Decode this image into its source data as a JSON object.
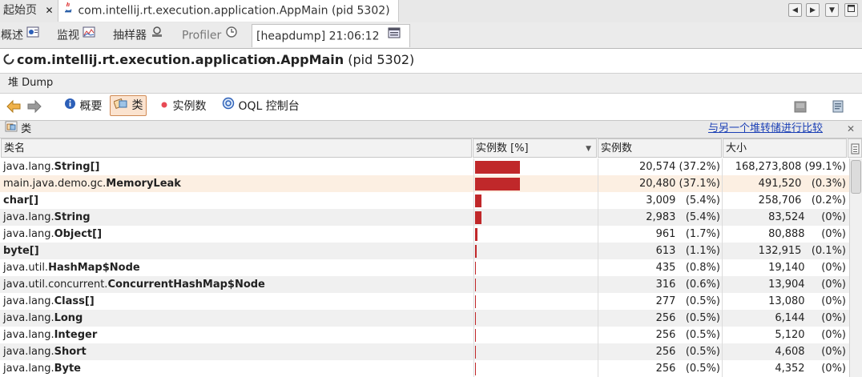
{
  "doc_tabs": [
    {
      "label": "起始页"
    },
    {
      "label": "com.intellij.rt.execution.application.AppMain (pid 5302)"
    }
  ],
  "sub_tabs": [
    {
      "label": "概述"
    },
    {
      "label": "监视"
    },
    {
      "label": "抽样器"
    },
    {
      "label": "Profiler"
    },
    {
      "label": "[heapdump] 21:06:12"
    }
  ],
  "title": {
    "app": "com.intellij.rt.execution.application.AppMain",
    "pid": "(pid 5302)"
  },
  "heap_dump_label": "堆 Dump",
  "toolbar": {
    "summary": "概要",
    "classes": "类",
    "instances": "实例数",
    "oql": "OQL 控制台"
  },
  "classes_panel": {
    "title": "类",
    "compare_link": "与另一个堆转储进行比较"
  },
  "columns": {
    "name": "类名",
    "instances_pct": "实例数 [%]",
    "instances": "实例数",
    "size": "大小"
  },
  "rows": [
    {
      "pkg": "java.lang.",
      "cls": "String[]",
      "pct": 37.2,
      "inst": "20,574 (37.2%)",
      "size": "168,273,808 (99.1%)"
    },
    {
      "pkg": "main.java.demo.gc.",
      "cls": "MemoryLeak",
      "pct": 37.1,
      "inst": "20,480 (37.1%)",
      "size": "491,520   (0.3%)"
    },
    {
      "pkg": "",
      "cls": "char[]",
      "pct": 5.4,
      "inst": "3,009   (5.4%)",
      "size": "258,706   (0.2%)"
    },
    {
      "pkg": "java.lang.",
      "cls": "String",
      "pct": 5.4,
      "inst": "2,983   (5.4%)",
      "size": "83,524     (0%)"
    },
    {
      "pkg": "java.lang.",
      "cls": "Object[]",
      "pct": 1.7,
      "inst": "961   (1.7%)",
      "size": "80,888     (0%)"
    },
    {
      "pkg": "",
      "cls": "byte[]",
      "pct": 1.1,
      "inst": "613   (1.1%)",
      "size": "132,915   (0.1%)"
    },
    {
      "pkg": "java.util.",
      "cls": "HashMap$Node",
      "pct": 0.8,
      "inst": "435   (0.8%)",
      "size": "19,140     (0%)"
    },
    {
      "pkg": "java.util.concurrent.",
      "cls": "ConcurrentHashMap$Node",
      "pct": 0.6,
      "inst": "316   (0.6%)",
      "size": "13,904     (0%)"
    },
    {
      "pkg": "java.lang.",
      "cls": "Class[]",
      "pct": 0.5,
      "inst": "277   (0.5%)",
      "size": "13,080     (0%)"
    },
    {
      "pkg": "java.lang.",
      "cls": "Long",
      "pct": 0.5,
      "inst": "256   (0.5%)",
      "size": "6,144     (0%)"
    },
    {
      "pkg": "java.lang.",
      "cls": "Integer",
      "pct": 0.5,
      "inst": "256   (0.5%)",
      "size": "5,120     (0%)"
    },
    {
      "pkg": "java.lang.",
      "cls": "Short",
      "pct": 0.5,
      "inst": "256   (0.5%)",
      "size": "4,608     (0%)"
    },
    {
      "pkg": "java.lang.",
      "cls": "Byte",
      "pct": 0.5,
      "inst": "256   (0.5%)",
      "size": "4,352     (0%)"
    }
  ],
  "colors": {
    "bar": "#c0282a",
    "selected_row": "#fcefe2",
    "link": "#1a3fb5"
  }
}
